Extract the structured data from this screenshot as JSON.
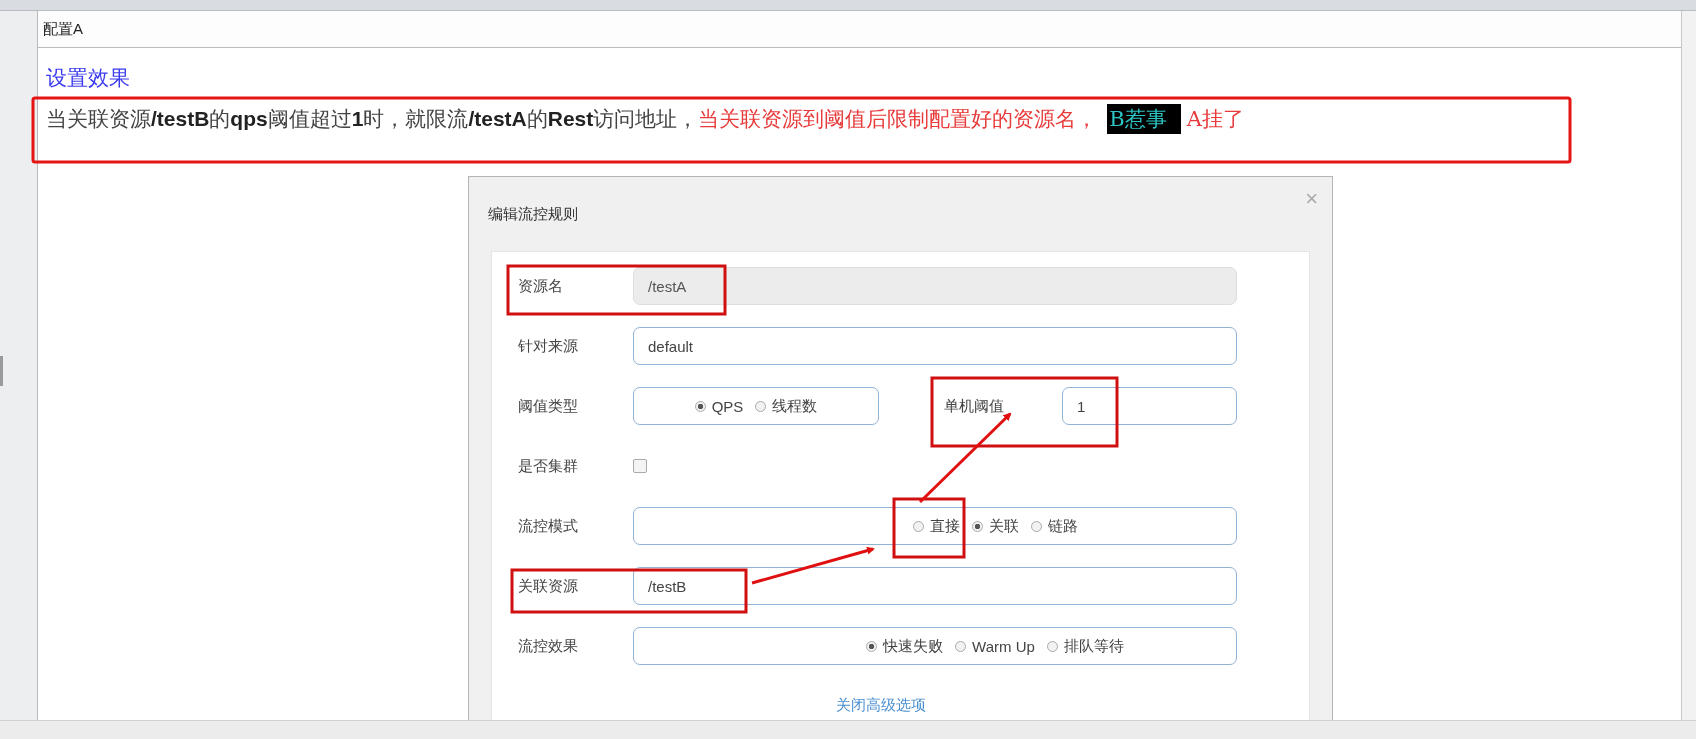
{
  "tab": {
    "label": "配置A"
  },
  "heading": "设置效果",
  "note": [
    {
      "kind": "plain",
      "text": "当关联资源**/testB**的**qps**阈值超过**1**时，就限流**/testA**的**Rest**访问地址，"
    },
    {
      "kind": "red",
      "text": "当关联资源到阈值后限制配置好的资源名，"
    },
    {
      "kind": "highlight",
      "text": "B惹事"
    },
    {
      "kind": "red",
      "text": "A挂了"
    }
  ],
  "dialog": {
    "title": "编辑流控规则",
    "close": "×",
    "fields": [
      {
        "kind": "input",
        "label": "资源名",
        "value": "/testA",
        "disabled": true
      },
      {
        "kind": "input",
        "label": "针对来源",
        "value": "default",
        "disabled": false
      },
      {
        "kind": "radio",
        "label": "阈值类型",
        "options": [
          {
            "label": "QPS",
            "selected": true
          },
          {
            "label": "线程数",
            "selected": false
          }
        ],
        "side": {
          "label": "单机阈值",
          "value": "1"
        }
      },
      {
        "kind": "checkbox",
        "label": "是否集群",
        "checked": false
      },
      {
        "kind": "radio",
        "label": "流控模式",
        "options": [
          {
            "label": "直接",
            "selected": false
          },
          {
            "label": "关联",
            "selected": true
          },
          {
            "label": "链路",
            "selected": false
          }
        ]
      },
      {
        "kind": "input",
        "label": "关联资源",
        "value": "/testB",
        "disabled": false
      },
      {
        "kind": "radio",
        "label": "流控效果",
        "options": [
          {
            "label": "快速失败",
            "selected": true
          },
          {
            "label": "Warm Up",
            "selected": false
          },
          {
            "label": "排队等待",
            "selected": false
          }
        ]
      }
    ],
    "link": "关闭高级选项"
  }
}
